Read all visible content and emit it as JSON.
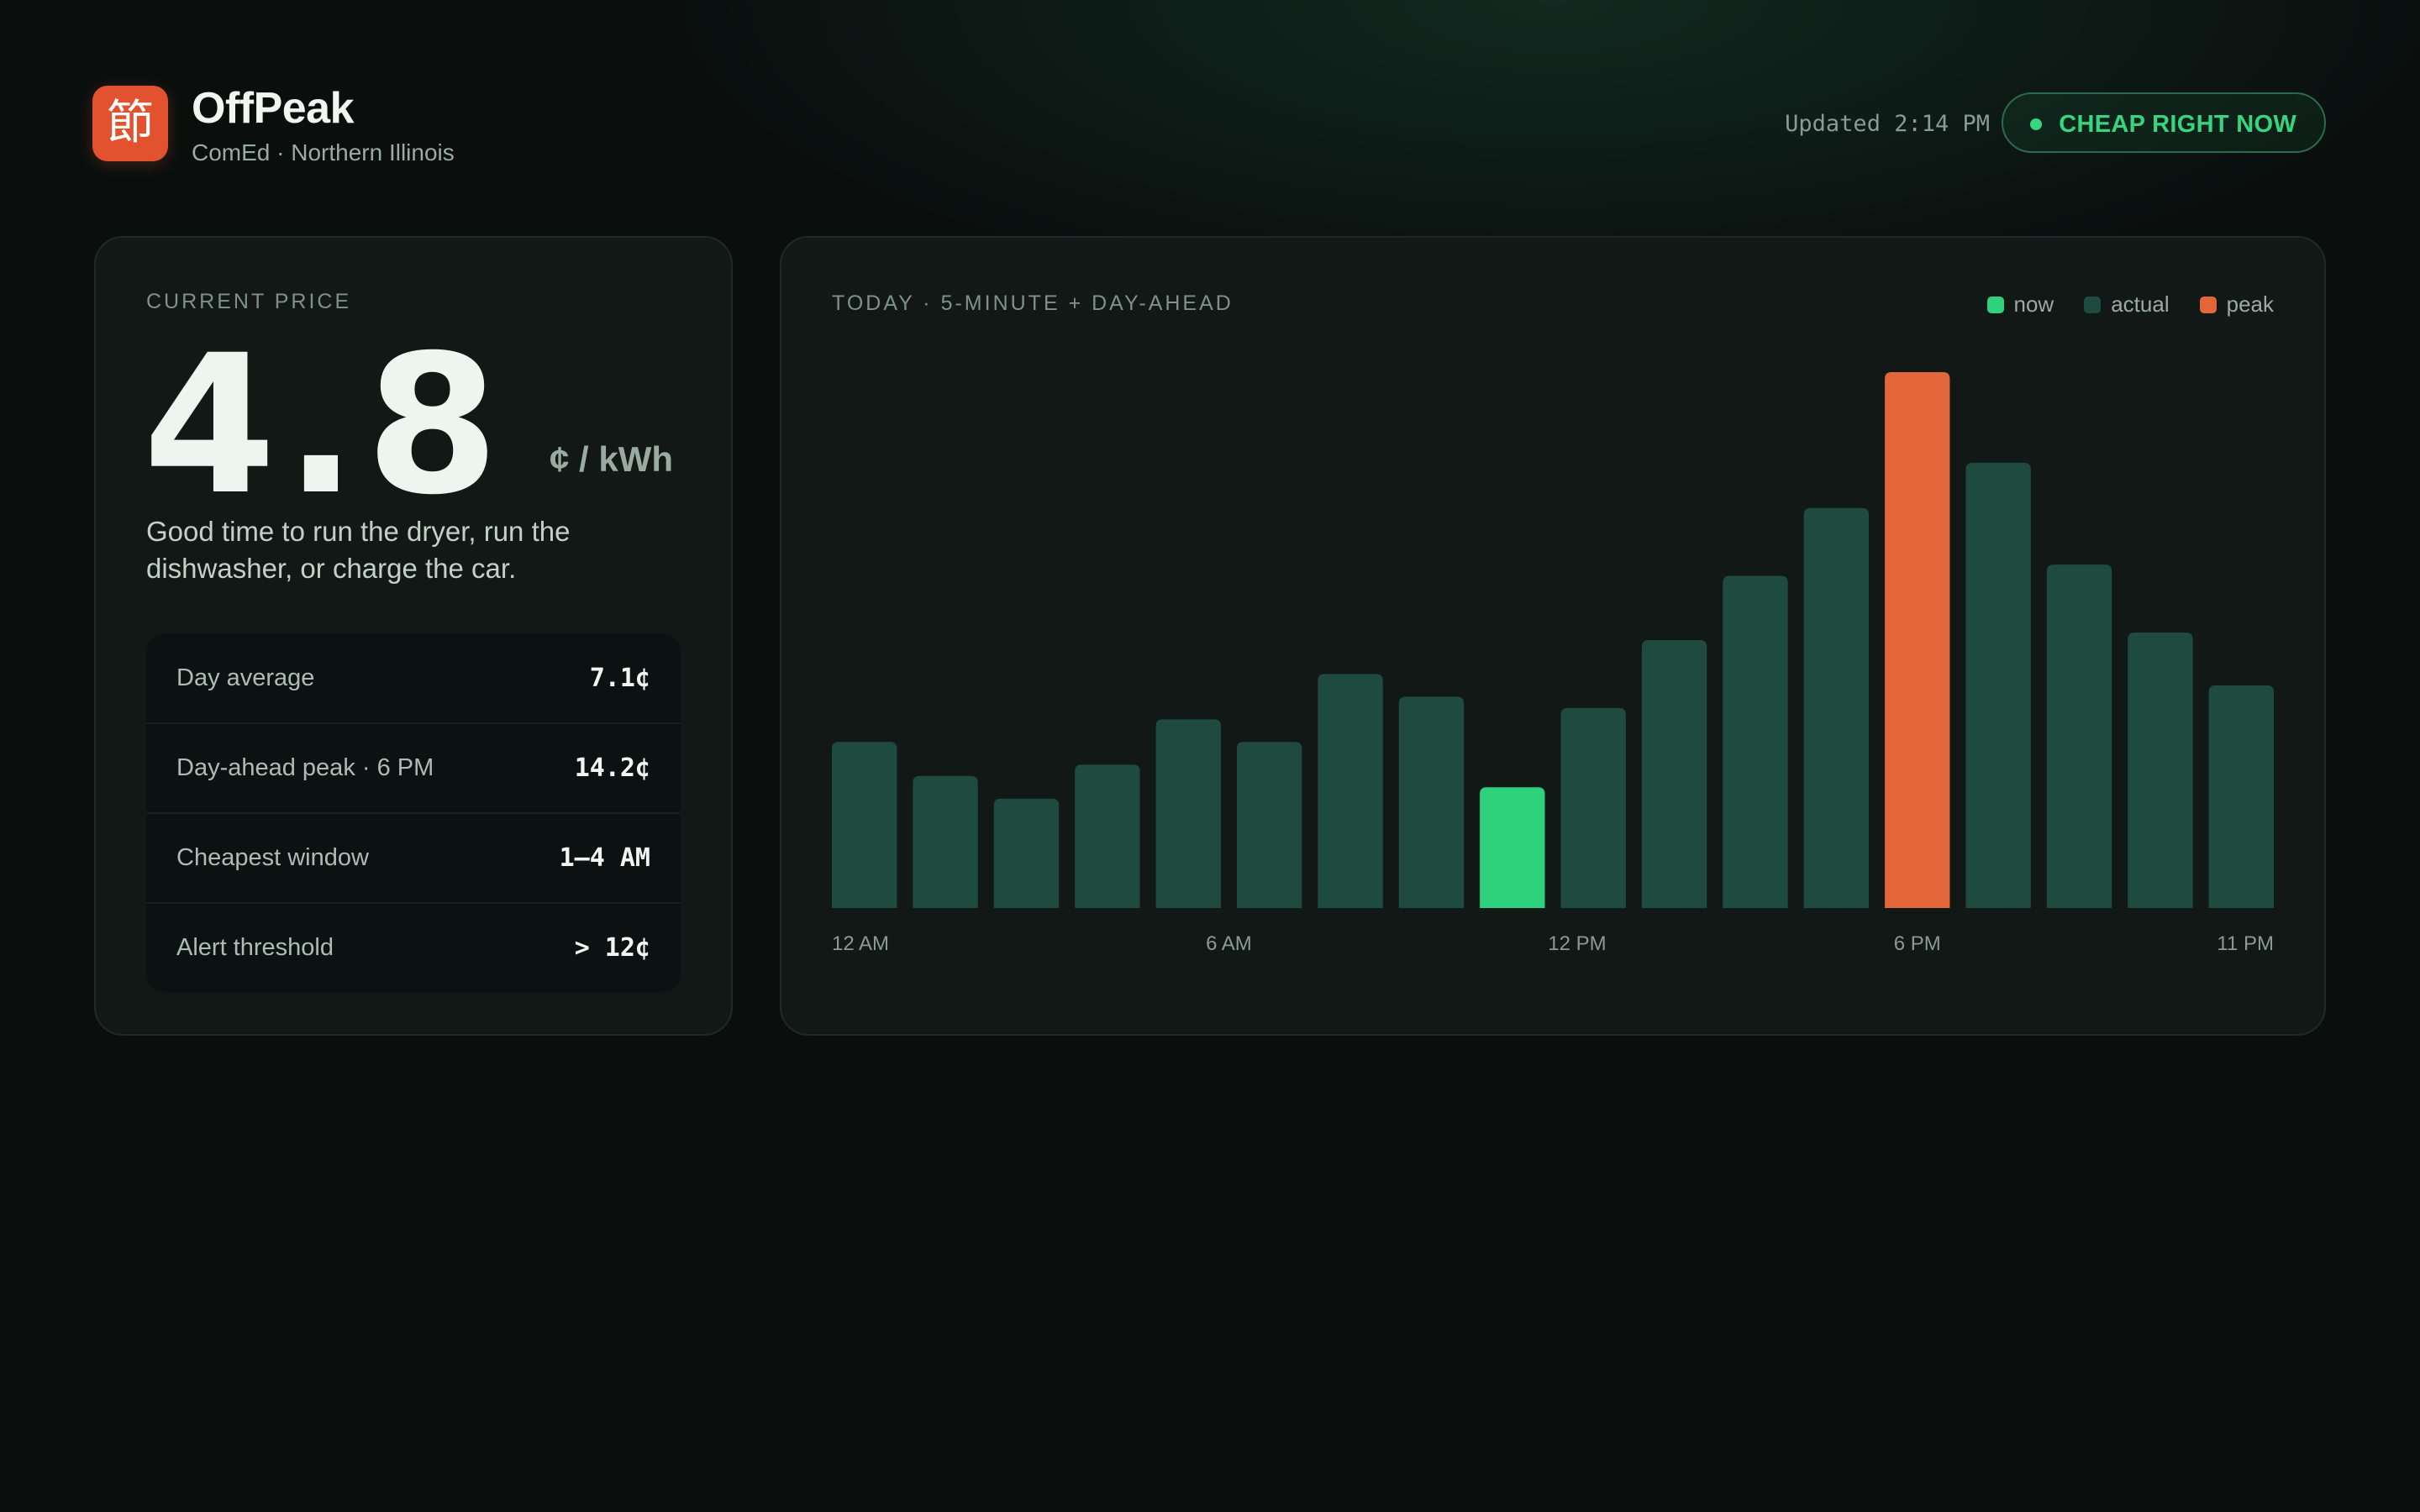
{
  "app": {
    "logo_glyph": "節",
    "name": "OffPeak",
    "subtitle": "ComEd · Northern Illinois"
  },
  "header": {
    "updated": "Updated 2:14 PM",
    "status": "CHEAP RIGHT NOW"
  },
  "price_card": {
    "label": "CURRENT PRICE",
    "value": "4.8",
    "unit": "¢ / kWh",
    "advice": "Good time to run the dryer, run the dishwasher, or charge the car.",
    "stats": [
      {
        "label": "Day average",
        "value": "7.1¢"
      },
      {
        "label": "Day-ahead peak · 6 PM",
        "value": "14.2¢"
      },
      {
        "label": "Cheapest window",
        "value": "1–4 AM"
      },
      {
        "label": "Alert threshold",
        "value": "> 12¢"
      }
    ]
  },
  "chart_card": {
    "title": "TODAY · 5-MINUTE + DAY-AHEAD",
    "legend": [
      {
        "label": "now",
        "color": "#2fd27c"
      },
      {
        "label": "actual",
        "color": "#1f4a40"
      },
      {
        "label": "peak",
        "color": "#e2663a"
      }
    ]
  },
  "colors": {
    "accent_green": "#38d47f",
    "bar_actual": "#1f4a40",
    "bar_now": "#2fd27c",
    "bar_peak": "#e2663a",
    "logo": "#e2522f"
  },
  "chart_data": {
    "type": "bar",
    "title": "TODAY · 5-MINUTE + DAY-AHEAD",
    "ylim": [
      0,
      14.2
    ],
    "values": [
      4.4,
      3.5,
      2.9,
      3.8,
      5.0,
      4.4,
      6.2,
      5.6,
      3.2,
      5.3,
      7.1,
      8.8,
      10.6,
      14.2,
      11.8,
      9.1,
      7.3,
      5.9
    ],
    "kinds": [
      "actual",
      "actual",
      "actual",
      "actual",
      "actual",
      "actual",
      "actual",
      "actual",
      "now",
      "actual",
      "actual",
      "actual",
      "actual",
      "peak",
      "actual",
      "actual",
      "actual",
      "actual"
    ],
    "x_tick_labels": [
      "12 AM",
      "6 AM",
      "12 PM",
      "6 PM",
      "11 PM"
    ],
    "x_tick_bar_index": [
      0,
      4.5,
      8.8,
      13,
      17
    ],
    "legend": [
      "now",
      "actual",
      "peak"
    ],
    "legend_position": "top-right",
    "grid": false
  }
}
